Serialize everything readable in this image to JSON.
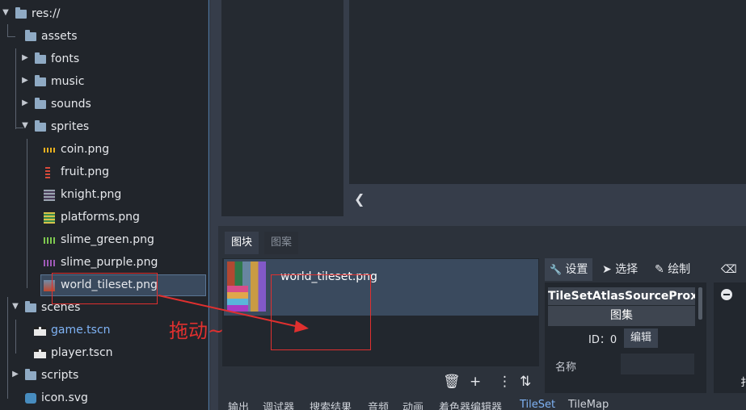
{
  "filesystem": {
    "root": "res://",
    "items": [
      {
        "label": "assets",
        "type": "folder"
      },
      {
        "label": "fonts",
        "type": "folder"
      },
      {
        "label": "music",
        "type": "folder"
      },
      {
        "label": "sounds",
        "type": "folder"
      },
      {
        "label": "sprites",
        "type": "folder"
      },
      {
        "label": "coin.png",
        "type": "image"
      },
      {
        "label": "fruit.png",
        "type": "image"
      },
      {
        "label": "knight.png",
        "type": "image"
      },
      {
        "label": "platforms.png",
        "type": "image"
      },
      {
        "label": "slime_green.png",
        "type": "image"
      },
      {
        "label": "slime_purple.png",
        "type": "image"
      },
      {
        "label": "world_tileset.png",
        "type": "image"
      },
      {
        "label": "scenes",
        "type": "folder"
      },
      {
        "label": "game.tscn",
        "type": "scene"
      },
      {
        "label": "player.tscn",
        "type": "scene"
      },
      {
        "label": "scripts",
        "type": "folder"
      },
      {
        "label": "icon.svg",
        "type": "svg"
      }
    ]
  },
  "panel": {
    "tabs": [
      {
        "label": "图块"
      },
      {
        "label": "图案"
      }
    ],
    "source_item": "world_tileset.png",
    "toolbar": {
      "settings": "设置",
      "select": "选择",
      "paint": "绘制"
    },
    "inspector": {
      "title": "TileSetAtlasSourceProxy...",
      "subtitle": "图集",
      "id_label": "ID：0",
      "edit_button": "编辑",
      "name_label": "名称"
    },
    "far_char": "扌"
  },
  "viewport": {
    "collapse_glyph": "❮"
  },
  "dock_tabs": [
    "输出",
    "调试器",
    "搜索结果",
    "音频",
    "动画",
    "着色器编辑器",
    "TileSet",
    "TileMap"
  ],
  "dock_active": "TileSet",
  "annotation": {
    "text": "拖动~",
    "color": "#e0302f"
  }
}
